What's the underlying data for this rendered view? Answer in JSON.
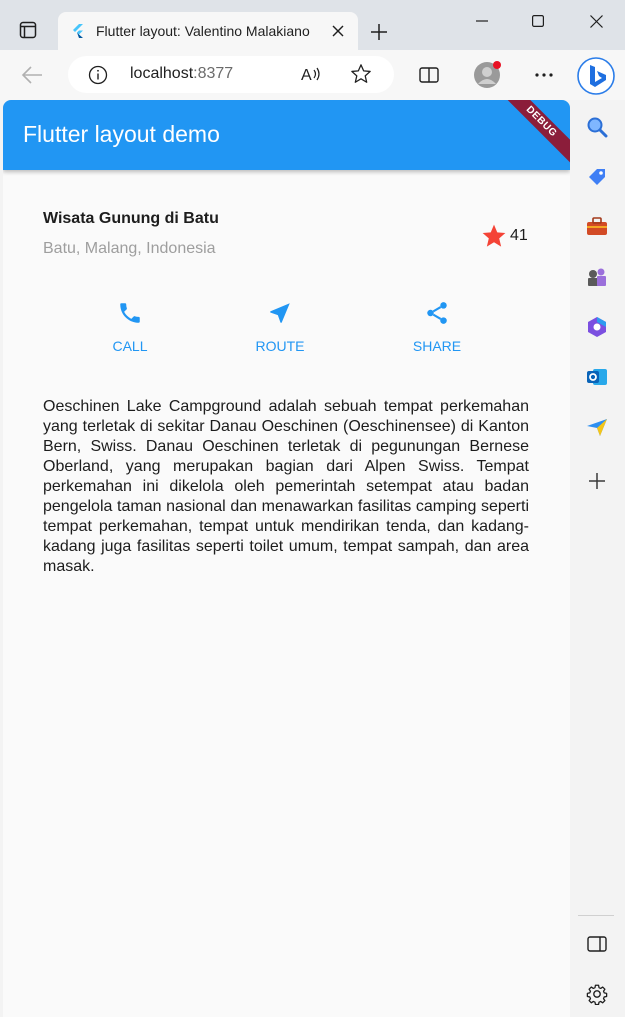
{
  "browser": {
    "tab_title": "Flutter layout: Valentino Malakiano",
    "url_host": "localhost",
    "url_port": ":8377"
  },
  "app": {
    "title": "Flutter layout demo",
    "debug_banner": "DEBUG",
    "place": {
      "name": "Wisata Gunung di Batu",
      "location": "Batu, Malang, Indonesia",
      "rating": "41"
    },
    "actions": [
      {
        "label": "CALL",
        "icon": "phone-icon"
      },
      {
        "label": "ROUTE",
        "icon": "navigation-icon"
      },
      {
        "label": "SHARE",
        "icon": "share-icon"
      }
    ],
    "description": "Oeschinen Lake Campground adalah sebuah tempat perkemahan yang terletak di sekitar Danau Oeschinen (Oeschinensee) di Kanton Bern, Swiss. Danau Oeschinen terletak di pegunungan Bernese Oberland, yang merupakan bagian dari Alpen Swiss. Tempat perkemahan ini dikelola oleh pemerintah setempat atau badan pengelola taman nasional dan menawarkan fasilitas camping seperti tempat perkemahan, tempat untuk mendirikan tenda, dan kadang-kadang juga fasilitas seperti toilet umum, tempat sampah, dan area masak."
  },
  "colors": {
    "primary": "#2196f3",
    "star": "#f44336",
    "debug": "#8b1d3a"
  }
}
